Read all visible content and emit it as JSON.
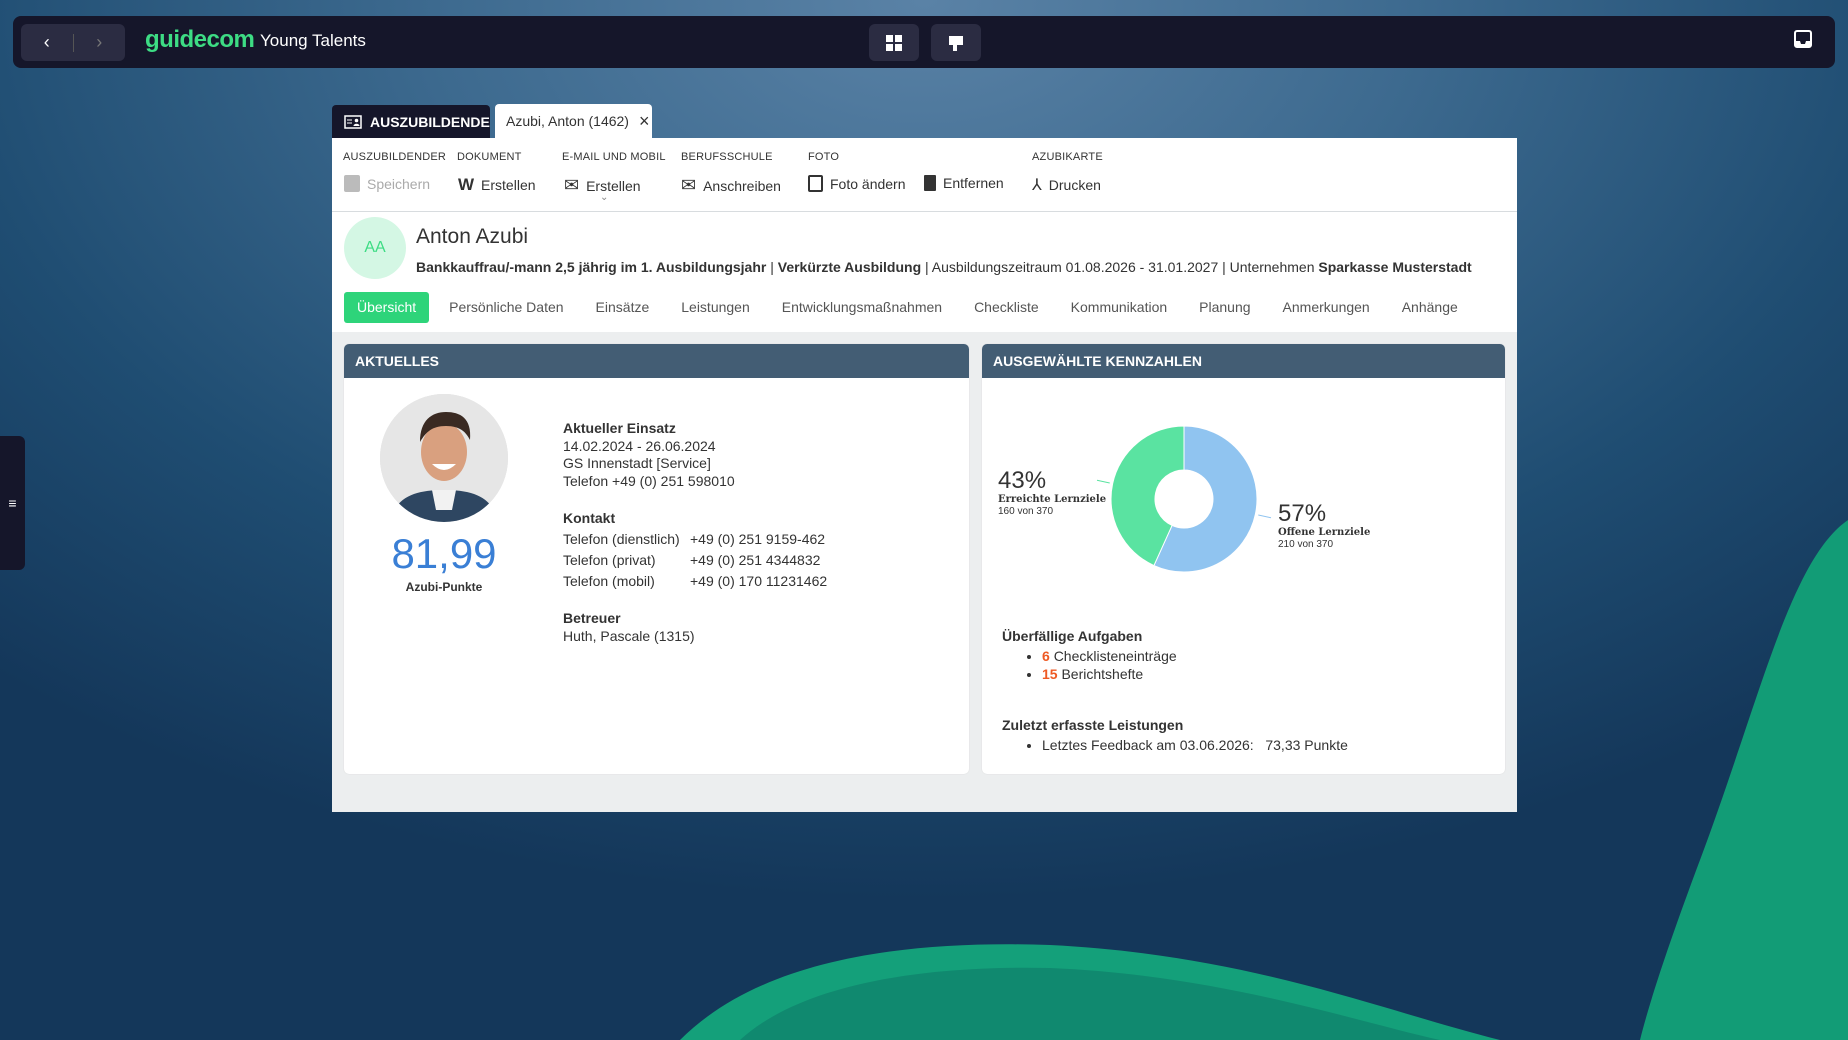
{
  "topbar": {
    "back": "‹",
    "forward": "›",
    "logo": "guidecom",
    "title": "Young Talents"
  },
  "tabs": {
    "main": "AUSZUBILDENDE",
    "record": "Azubi, Anton (1462)",
    "close": "×"
  },
  "toolbar": {
    "groups": [
      "AUSZUBILDENDER",
      "DOKUMENT",
      "E-MAIL UND MOBIL",
      "BERUFSSCHULE",
      "FOTO",
      "AZUBIKARTE"
    ],
    "save": "Speichern",
    "doc_create": "Erstellen",
    "mail_create": "Erstellen",
    "write": "Anschreiben",
    "photo_change": "Foto ändern",
    "remove": "Entfernen",
    "print": "Drucken"
  },
  "profile": {
    "initials": "AA",
    "name": "Anton Azubi",
    "sub": {
      "job": "Bankkauffrau/-mann 2,5 jährig im 1. Ausbildungsjahr",
      "sep": " | ",
      "short": "Verkürzte Ausbildung",
      "period_label": "Ausbildungszeitraum",
      "period": "01.08.2026 - 31.01.2027",
      "company_label": "Unternehmen",
      "company": "Sparkasse Musterstadt"
    }
  },
  "nav": [
    "Übersicht",
    "Persönliche Daten",
    "Einsätze",
    "Leistungen",
    "Entwicklungsmaßnahmen",
    "Checkliste",
    "Kommunikation",
    "Planung",
    "Anmerkungen",
    "Anhänge"
  ],
  "aktuelles": {
    "title": "AKTUELLES",
    "points": "81,99",
    "points_label": "Azubi-Punkte",
    "einsatz": {
      "title": "Aktueller Einsatz",
      "dates": "14.02.2024 - 26.06.2024",
      "place": "GS Innenstadt [Service]",
      "phone": "Telefon +49 (0) 251 598010"
    },
    "kontakt": {
      "title": "Kontakt",
      "rows": [
        [
          "Telefon (dienstlich)",
          "+49 (0) 251 9159-462"
        ],
        [
          "Telefon (privat)",
          "+49 (0) 251 4344832"
        ],
        [
          "Telefon (mobil)",
          "+49 (0) 170 11231462"
        ]
      ]
    },
    "betreuer": {
      "title": "Betreuer",
      "name": "Huth, Pascale (1315)"
    }
  },
  "kennzahlen": {
    "title": "AUSGEWÄHLTE KENNZAHLEN",
    "overdue": {
      "title": "Überfällige Aufgaben",
      "items": [
        {
          "count": "6",
          "label": "Checklisteneinträge"
        },
        {
          "count": "15",
          "label": "Berichtshefte"
        }
      ]
    },
    "recent": {
      "title": "Zuletzt erfasste Leistungen",
      "item": "Letztes Feedback am 03.06.2026:   73,33 Punkte"
    }
  },
  "chart_data": {
    "type": "pie",
    "donut": true,
    "slices": [
      {
        "label": "Offene Lernziele",
        "value": 210,
        "total": 370,
        "percent": "57%",
        "detail": "210 von 370",
        "color": "#90c4f0"
      },
      {
        "label": "Erreichte Lernziele",
        "value": 160,
        "total": 370,
        "percent": "43%",
        "detail": "160 von 370",
        "color": "#5ae3a1"
      }
    ]
  },
  "colors": {
    "accent": "#2ed47a",
    "header": "#435d74",
    "dark": "#15162a",
    "highlight": "#ee5a24"
  }
}
